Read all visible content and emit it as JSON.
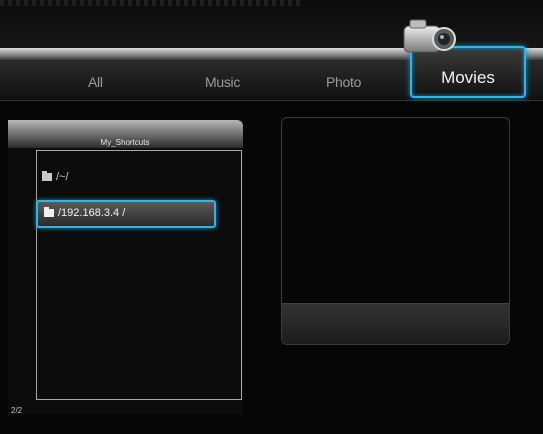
{
  "tabs": {
    "all": "All",
    "music": "Music",
    "photo": "Photo",
    "movies": "Movies"
  },
  "shortcuts": {
    "title": "My_Shortcuts",
    "items": [
      {
        "label": "/~/",
        "icon": "folder-icon",
        "selected": false
      },
      {
        "label": "/192.168.3.4 /",
        "icon": "folder-icon",
        "selected": true
      }
    ],
    "page_indicator": "2/2"
  },
  "colors": {
    "highlight": "#29b6e8",
    "background": "#060606"
  },
  "icons": {
    "active_tab": "video-camera-icon"
  }
}
